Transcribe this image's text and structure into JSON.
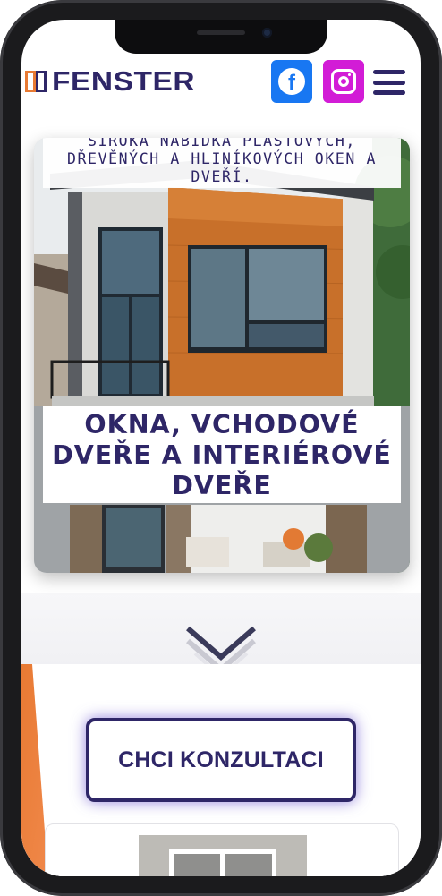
{
  "brand": {
    "name": "FENSTER",
    "primary_color": "#2e2667",
    "accent_color": "#e87a33"
  },
  "header": {
    "facebook_icon": "facebook-icon",
    "instagram_icon": "instagram-icon",
    "menu_icon": "hamburger-menu-icon",
    "facebook_color": "#1877f2",
    "instagram_color": "#d21cd6"
  },
  "hero": {
    "subtitle": "ŠIROKÁ NABÍDKA PLASTOVÝCH, DŘEVĚNÝCH A HLINÍKOVÝCH OKEN A DVEŘÍ.",
    "title": "OKNA, VCHODOVÉ DVEŘE A INTERIÉROVÉ DVEŘE",
    "scroll_icon": "chevron-down-icon"
  },
  "cta": {
    "label": "CHCI KONZULTACI"
  }
}
